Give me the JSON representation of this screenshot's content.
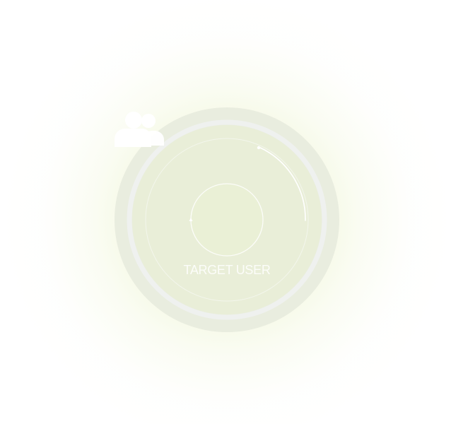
{
  "widget": {
    "caption": "TARGET USER",
    "icon": "users-icon",
    "colors": {
      "glow": "#e6efbf",
      "disc": "#e9eee0",
      "ring": "#f2f4f4",
      "icon": "#ffffff",
      "text": "#ffffff"
    }
  }
}
